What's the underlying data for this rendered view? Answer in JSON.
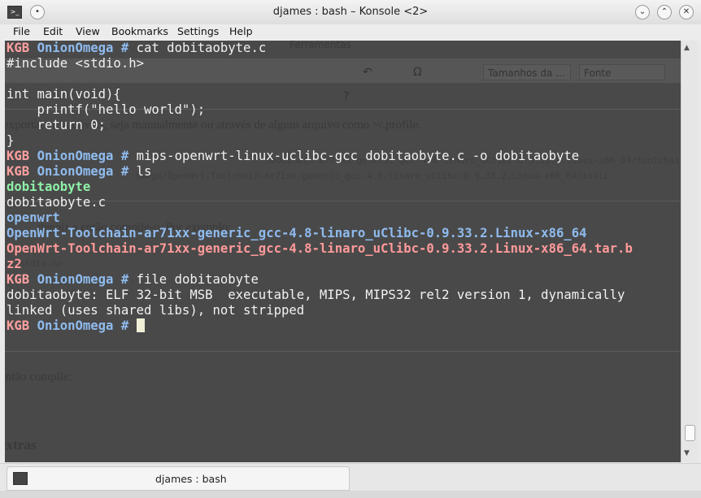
{
  "window": {
    "title": "djames : bash – Konsole <2>",
    "icons": [
      "terminal-app-icon",
      "pin-icon",
      "minimize-icon",
      "maximize-icon",
      "close-icon"
    ]
  },
  "menu": [
    "File",
    "Edit",
    "View",
    "Bookmarks",
    "Settings",
    "Help"
  ],
  "background_doc": {
    "menu_fragment": "Ferramentas",
    "font_size_select": "Tamanhos da ...",
    "font_select": "Fonte",
    "text_1": "exportar as variáveis, seja manualmente ou através de algum arquivo como ~/.profile.",
    "path_1": "Toolchain-ar71xx-generic_gcc-4.8-linaro_uClibc-0.9.33.2.Linux-x86_64/toolchain-mi",
    "path_2": "tmega/OpenWrt-Toolchain-ar71xx-generic_gcc-4.8-linaro_uClibc-0.9.33.2.Linux-x86_64/toolc",
    "text_2": "depois e então compile-o. Por exemplo:",
    "include_2": "stdio.h>",
    "text_3": "então compile:",
    "heading": "extras"
  },
  "terminal": {
    "prompt_host": "KGB",
    "prompt_user": "OnionOmega",
    "prompt_symbol": "#",
    "cmd_1": "cat dobitaobyte.c",
    "code": [
      "#include <stdio.h>",
      "",
      "int main(void){",
      "    printf(\"hello world\");",
      "    return 0;",
      "}"
    ],
    "cmd_2": "mips-openwrt-linux-uclibc-gcc dobitaobyte.c -o dobitaobyte",
    "cmd_3": "ls",
    "ls_exec": "dobitaobyte",
    "ls_file": "dobitaobyte.c",
    "ls_dir_1": "openwrt",
    "ls_dir_2": "OpenWrt-Toolchain-ar71xx-generic_gcc-4.8-linaro_uClibc-0.9.33.2.Linux-x86_64",
    "ls_archive": "OpenWrt-Toolchain-ar71xx-generic_gcc-4.8-linaro_uClibc-0.9.33.2.Linux-x86_64.tar.b",
    "ls_archive_cont": "z2",
    "cmd_4": "file dobitaobyte",
    "file_out_1": "dobitaobyte: ELF 32-bit MSB  executable, MIPS, MIPS32 rel2 version 1, dynamically",
    "file_out_2": "linked (uses shared libs), not stripped"
  },
  "tabs": [
    {
      "label": "djames : bash"
    }
  ]
}
